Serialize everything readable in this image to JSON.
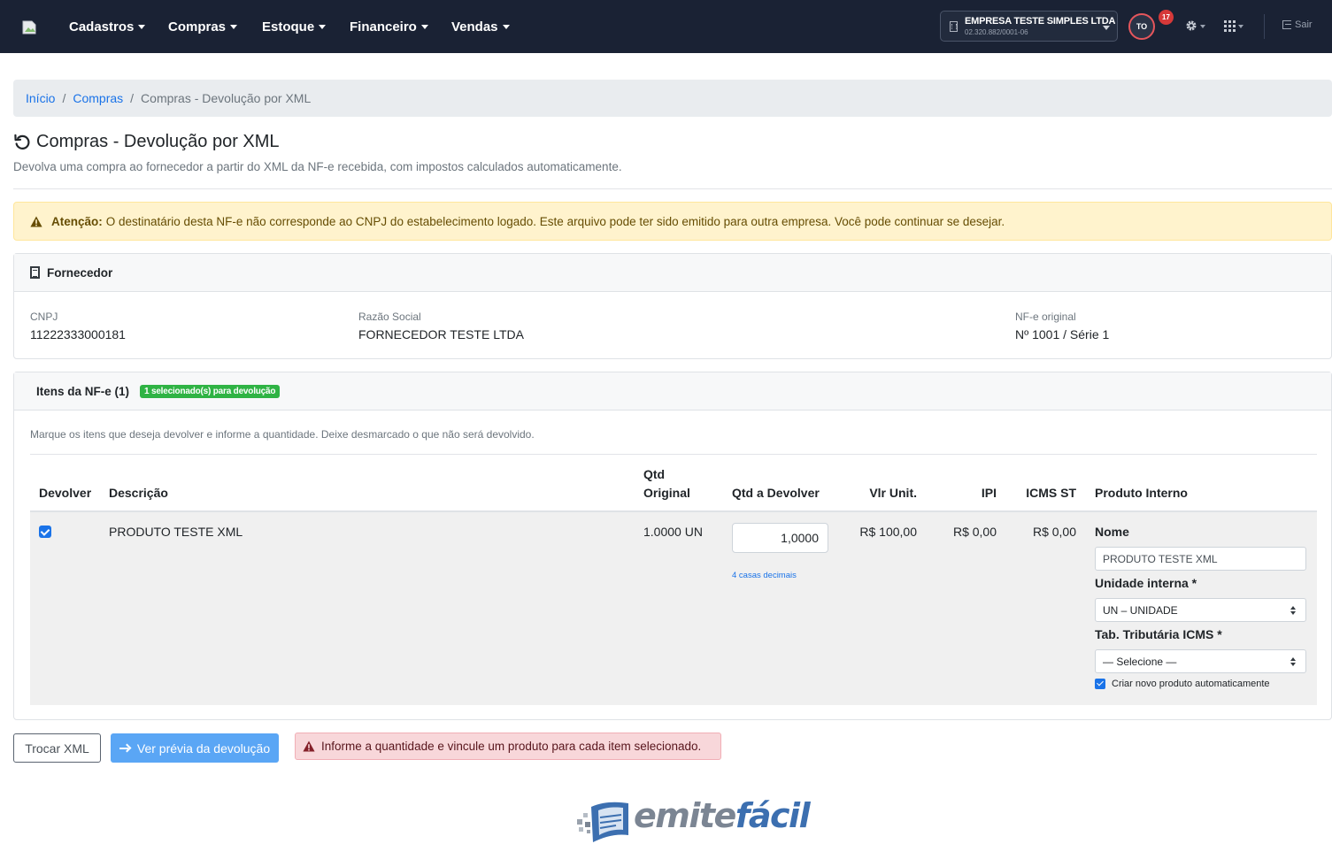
{
  "navbar": {
    "menu": [
      {
        "label": "Cadastros"
      },
      {
        "label": "Compras"
      },
      {
        "label": "Estoque"
      },
      {
        "label": "Financeiro"
      },
      {
        "label": "Vendas"
      }
    ],
    "company": {
      "name": "EMPRESA TESTE SIMPLES LTDA",
      "cnpj": "02.320.882/0001-06"
    },
    "user_initials": "TO",
    "notification_count": "17",
    "logout_label": "Sair",
    "icons": [
      "building-icon",
      "gear-icon",
      "apps-grid-icon",
      "logout-icon"
    ]
  },
  "breadcrumb": {
    "items": [
      {
        "label": "Início"
      },
      {
        "label": "Compras"
      }
    ],
    "current": "Compras - Devolução por XML",
    "separator": "/"
  },
  "page": {
    "title": "Compras - Devolução por XML",
    "subtitle": "Devolva uma compra ao fornecedor a partir do XML da NF-e recebida, com impostos calculados automaticamente.",
    "title_icon": "undo-icon"
  },
  "warning": {
    "strong": "Atenção:",
    "text": "O destinatário desta NF-e não corresponde ao CNPJ do estabelecimento logado. Este arquivo pode ter sido emitido para outra empresa. Você pode continuar se desejar."
  },
  "fornecedor": {
    "title": "Fornecedor",
    "cnpj_label": "CNPJ",
    "cnpj_value": "11222333000181",
    "razao_label": "Razão Social",
    "razao_value": "FORNECEDOR TESTE LTDA",
    "nfe_label": "NF-e original",
    "nfe_value": "Nº 1001 / Série 1"
  },
  "itens": {
    "title": "Itens da NF-e (1)",
    "badge": "1 selecionado(s) para devolução",
    "hint": "Marque os itens que deseja devolver e informe a quantidade. Deixe desmarcado o que não será devolvido.",
    "headers": {
      "devolver": "Devolver",
      "descricao": "Descrição",
      "qtd_original_1": "Qtd",
      "qtd_original_2": "Original",
      "qtd_devolver": "Qtd a Devolver",
      "vlr_unit": "Vlr Unit.",
      "ipi": "IPI",
      "icms_st": "ICMS ST",
      "produto_interno": "Produto Interno"
    },
    "rows": [
      {
        "checked": true,
        "descricao": "PRODUTO TESTE XML",
        "qtd_original": "1.0000 UN",
        "qtd_devolver": "1,0000",
        "decimals_hint": "4 casas decimais",
        "vlr_unit": "R$ 100,00",
        "ipi": "R$ 0,00",
        "icms_st": "R$ 0,00",
        "produto": {
          "nome_label": "Nome",
          "nome_value": "PRODUTO TESTE XML",
          "unidade_label": "Unidade interna *",
          "unidade_value": "UN – UNIDADE",
          "tab_label": "Tab. Tributária ICMS *",
          "tab_value": "— Selecione —",
          "auto_create_label": "Criar novo produto automaticamente",
          "auto_create_checked": true
        }
      }
    ]
  },
  "actions": {
    "trocar_label": "Trocar XML",
    "previa_label": "Ver prévia da devolução",
    "error_text": "Informe a quantidade e vincule um produto para cada item selecionado."
  },
  "footer": {
    "logo_part1": "emite",
    "logo_part2": "fácil"
  },
  "colors": {
    "navbar_bg": "#1a2234",
    "primary": "#1a73e8",
    "primary_light_button": "#5aa6f5",
    "warning_bg": "#fff3cd",
    "danger_bg": "#f8d7da",
    "success_badge": "#2fb344"
  }
}
